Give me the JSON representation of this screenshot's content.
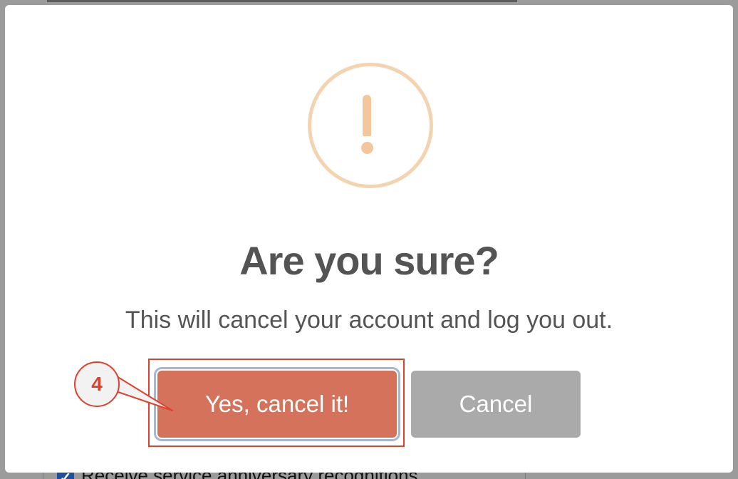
{
  "background": {
    "checkbox_label": "Receive service anniversary recognitions"
  },
  "dialog": {
    "icon": "warning-exclamation-icon",
    "title": "Are you sure?",
    "message": "This will cancel your account and log you out.",
    "confirm_label": "Yes, cancel it!",
    "cancel_label": "Cancel"
  },
  "annotation": {
    "step_number": "4"
  },
  "colors": {
    "confirm": "#d4725b",
    "cancel": "#aaaaaa",
    "warning": "#f3c69c",
    "highlight": "#e0402c"
  }
}
